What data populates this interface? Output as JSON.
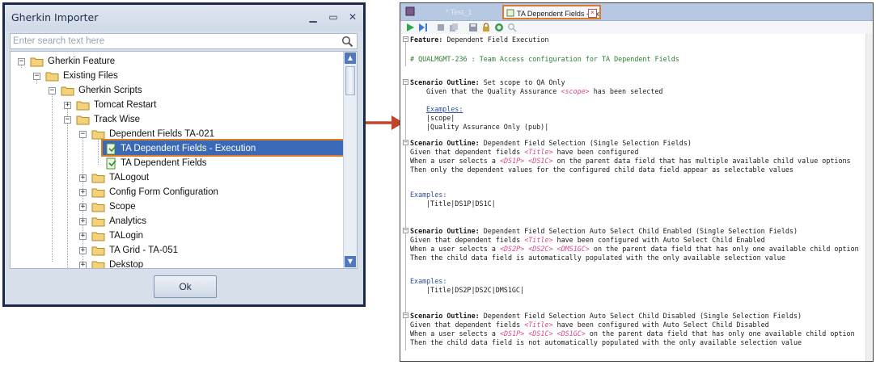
{
  "dialog": {
    "title": "Gherkin Importer",
    "search_placeholder": "Enter search text here",
    "ok_label": "Ok",
    "tree": [
      {
        "label": "Gherkin Feature"
      },
      {
        "label": "Existing Files"
      },
      {
        "label": "Gherkin Scripts"
      },
      {
        "label": "Tomcat Restart"
      },
      {
        "label": "Track Wise"
      },
      {
        "label": "Dependent Fields TA-021"
      },
      {
        "label": "TA Dependent Fields - Execution"
      },
      {
        "label": "TA Dependent Fields"
      },
      {
        "label": "TALogout"
      },
      {
        "label": "Config Form Configuration"
      },
      {
        "label": "Scope"
      },
      {
        "label": "Analytics"
      },
      {
        "label": "TALogin"
      },
      {
        "label": "TA Grid - TA-051"
      },
      {
        "label": "Dekstop"
      }
    ]
  },
  "editor": {
    "tabs": [
      {
        "label": "* Test_1"
      },
      {
        "label": "TA Dependent Fields - Ex"
      }
    ],
    "lines": [
      {
        "kw": "Feature:",
        "text": " Dependent Field Execution"
      },
      {
        "cm": "# QUALMGMT-236 : Team Access configuration for TA Dependent Fields"
      },
      {
        "kw": "Scenario Outline:",
        "text": " Set scope to QA Only"
      },
      {
        "pre": "Given that the Quality Assurance ",
        "pa": "<scope>",
        "post": " has been selected"
      },
      {
        "st": "Examples:"
      },
      {
        "text": "|scope|"
      },
      {
        "text": "|Quality Assurance Only (pub)|"
      },
      {
        "kw": "Scenario Outline:",
        "text": " Dependent Field Selection (Single Selection Fields)"
      },
      {
        "pre": "Given that dependent fields ",
        "pa": "<Title>",
        "post": " have been configured"
      },
      {
        "pre": "When a user selects a ",
        "pa": "<DS1P> <DS1C>",
        "post": " on the parent data field that has multiple available child value options"
      },
      {
        "text": "Then only the dependent values for the configured child data field appear as selectable values"
      },
      {
        "st": "Examples:"
      },
      {
        "text": "|Title|DS1P|DS1C|"
      },
      {
        "kw": "Scenario Outline:",
        "text": " Dependent Field Selection Auto Select Child Enabled (Single Selection Fields)"
      },
      {
        "pre": "Given that dependent fields ",
        "pa": "<Title>",
        "post": " have been configured with Auto Select Child Enabled"
      },
      {
        "pre": "When a user selects a ",
        "pa": "<DS2P> <DS2C> <DMS1GC>",
        "post": " on the parent data field that has only one available child option"
      },
      {
        "text": "Then the child data field is automatically populated with the only available selection value"
      },
      {
        "st": "Examples:"
      },
      {
        "text": "|Title|DS2P|DS2C|DMS1GC|"
      },
      {
        "kw": "Scenario Outline:",
        "text": " Dependent Field Selection Auto Select Child Disabled (Single Selection Fields)"
      },
      {
        "pre": "Given that dependent fields ",
        "pa": "<Title>",
        "post": " have been configured with Auto Select Child Disabled"
      },
      {
        "pre": "When a user selects a ",
        "pa": "<DS1P> <DS1C> <DS1GC>",
        "post": " on the parent data field that has only one available child option"
      },
      {
        "text": "Then the child data field is not automatically populated with the only available selection value"
      }
    ]
  },
  "colors": {
    "dialog_frame": "#1c2a4a",
    "selection": "#3a6ab7",
    "highlight_outline": "#e07a2b",
    "arrow": "#c0452a",
    "comment": "#2e7d2e",
    "param": "#d84b8a"
  }
}
